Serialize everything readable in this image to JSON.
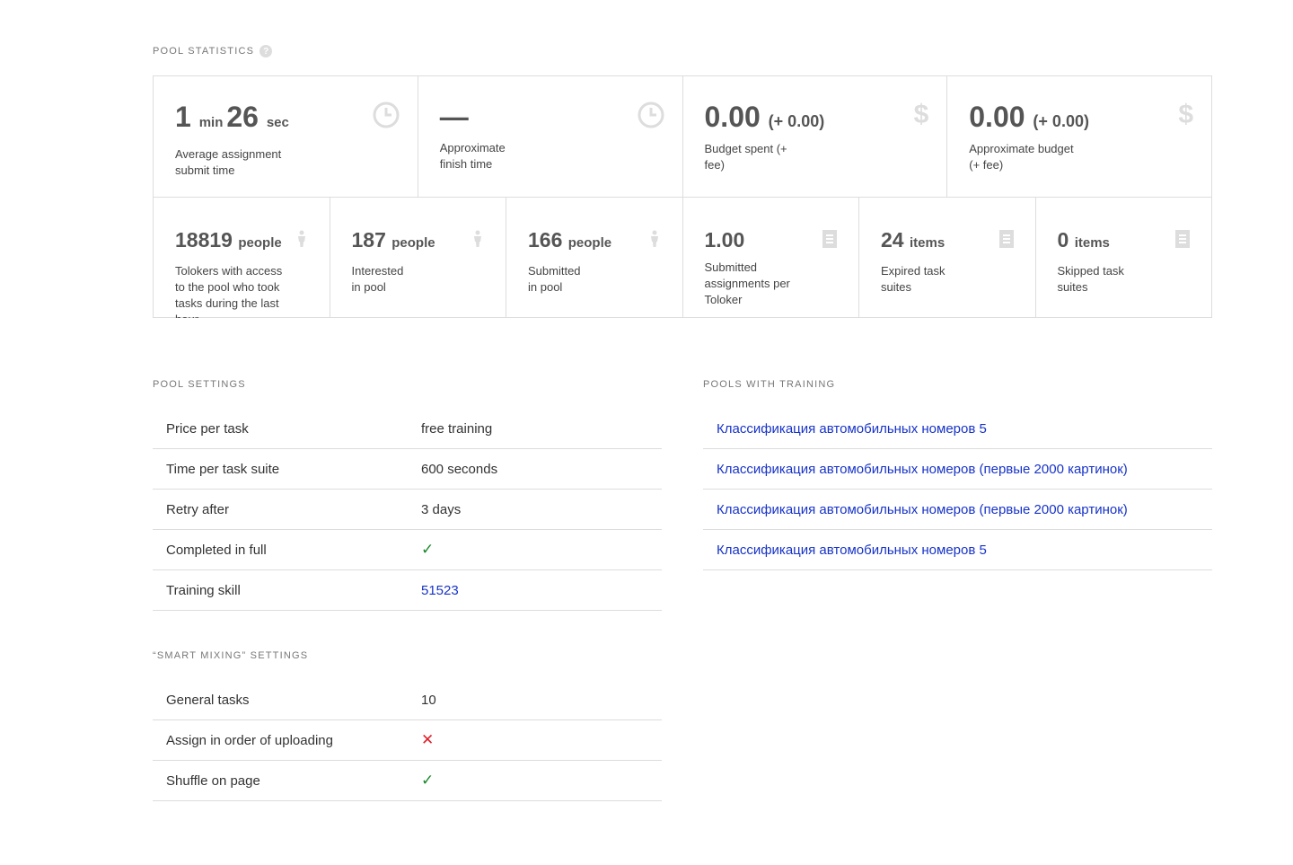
{
  "pool_statistics": {
    "title": "POOL STATISTICS",
    "help": "?",
    "top_cards": [
      {
        "value1": "1",
        "unit1": "min",
        "value2": "26",
        "unit2": "sec",
        "desc": "Average assignment submit time",
        "icon": "clock-icon"
      },
      {
        "value": "—",
        "desc": "Approximate finish time",
        "icon": "clock-icon"
      },
      {
        "value": "0.00",
        "extra": "(+ 0.00)",
        "desc": "Budget spent (+ fee)",
        "icon": "dollar-icon"
      },
      {
        "value": "0.00",
        "extra": "(+ 0.00)",
        "desc": "Approximate budget (+ fee)",
        "icon": "dollar-icon"
      }
    ],
    "bottom_cards": [
      {
        "value": "18819",
        "unit": "people",
        "desc": "Tolokers with access to the pool who took tasks during the last hour",
        "icon": "person-icon"
      },
      {
        "value": "187",
        "unit": "people",
        "desc": "Interested in pool",
        "icon": "person-icon"
      },
      {
        "value": "166",
        "unit": "people",
        "desc": "Submitted in pool",
        "icon": "person-icon"
      },
      {
        "value": "1.00",
        "unit": "",
        "desc": "Submitted assignments per Toloker",
        "icon": "document-icon"
      },
      {
        "value": "24",
        "unit": "items",
        "desc": "Expired task suites",
        "icon": "document-icon"
      },
      {
        "value": "0",
        "unit": "items",
        "desc": "Skipped task suites",
        "icon": "document-icon"
      }
    ]
  },
  "pool_settings": {
    "title": "POOL SETTINGS",
    "rows": [
      {
        "key": "Price per task",
        "value": "free training"
      },
      {
        "key": "Time per task suite",
        "value": "600 seconds"
      },
      {
        "key": "Retry after",
        "value": "3 days"
      },
      {
        "key": "Completed in full",
        "value": "✓"
      },
      {
        "key": "Training skill",
        "value": "51523"
      }
    ]
  },
  "smart_mixing": {
    "title": "“SMART MIXING” SETTINGS",
    "rows": [
      {
        "key": "General tasks",
        "value": "10"
      },
      {
        "key": "Assign in order of uploading",
        "value": "✕"
      },
      {
        "key": "Shuffle on page",
        "value": "✓"
      }
    ]
  },
  "pools_with_training": {
    "title": "POOLS WITH TRAINING",
    "items": [
      "Классификация автомобильных номеров 5",
      "Классификация автомобильных номеров (первые 2000 картинок)",
      "Классификация автомобильных номеров (первые 2000 картинок)",
      "Классификация автомобильных номеров 5"
    ]
  }
}
